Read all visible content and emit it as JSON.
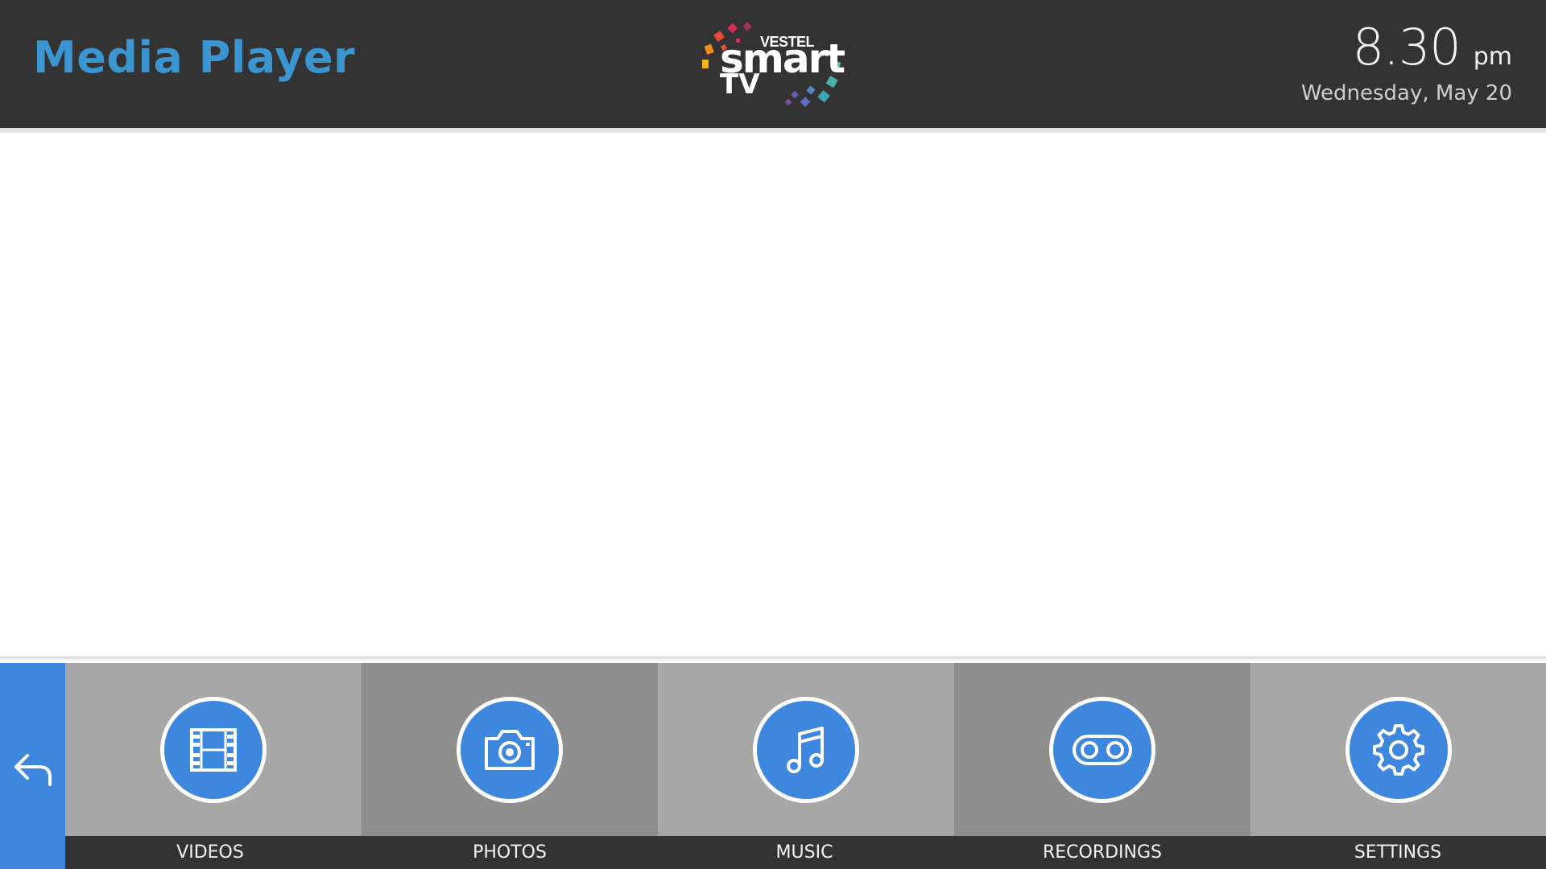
{
  "header": {
    "title": "Media Player",
    "logo": {
      "brand": "VESTEL",
      "word": "smart",
      "sub": "TV"
    },
    "clock": {
      "time": "8.30",
      "ampm": "pm",
      "date": "Wednesday, May 20"
    }
  },
  "menu": {
    "back_icon": "back-arrow-icon",
    "items": [
      {
        "label": "VIDEOS",
        "icon": "film-icon"
      },
      {
        "label": "PHOTOS",
        "icon": "camera-icon"
      },
      {
        "label": "MUSIC",
        "icon": "music-note-icon"
      },
      {
        "label": "RECORDINGS",
        "icon": "recording-tape-icon"
      },
      {
        "label": "SETTINGS",
        "icon": "gear-icon"
      }
    ]
  },
  "colors": {
    "header_bg": "#333333",
    "title": "#3a95d0",
    "accent": "#3d87df",
    "tile_light": "#a7a7a7",
    "tile_dark": "#8e8e8e",
    "label_bar": "#333333"
  }
}
